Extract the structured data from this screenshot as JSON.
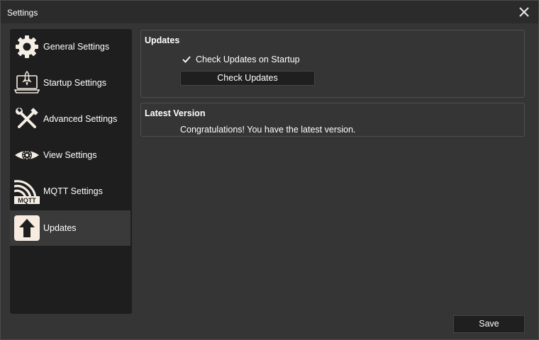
{
  "window": {
    "title": "Settings"
  },
  "sidebar": {
    "items": [
      {
        "label": "General Settings",
        "icon": "gear-icon"
      },
      {
        "label": "Startup Settings",
        "icon": "startup-laptop-icon"
      },
      {
        "label": "Advanced Settings",
        "icon": "wrench-screwdriver-icon"
      },
      {
        "label": "View Settings",
        "icon": "eye-icon"
      },
      {
        "label": "MQTT Settings",
        "icon": "mqtt-icon"
      },
      {
        "label": "Updates",
        "icon": "upload-arrow-icon",
        "active": true
      }
    ]
  },
  "updates_panel": {
    "title": "Updates",
    "check_on_startup_label": "Check Updates on Startup",
    "check_on_startup_checked": true,
    "check_button_label": "Check Updates"
  },
  "latest_version_panel": {
    "title": "Latest Version",
    "message": "Congratulations! You have the latest version."
  },
  "footer": {
    "save_label": "Save"
  },
  "colors": {
    "background": "#353535",
    "sidebar": "#1e1e1e",
    "active_item": "#3a3a3a",
    "button": "#1f1f1f",
    "text": "#ffffff"
  }
}
